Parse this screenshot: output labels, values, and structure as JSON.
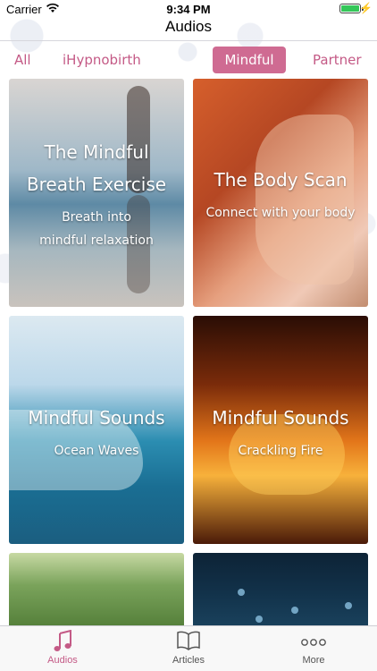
{
  "status_bar": {
    "carrier": "Carrier",
    "time": "9:34 PM"
  },
  "nav": {
    "title": "Audios"
  },
  "segments": [
    "All",
    "iHypnobirth",
    "Mindful",
    "Partner"
  ],
  "selected_segment": "Mindful",
  "cards": [
    {
      "title": "The Mindful Breath Exercise",
      "title_line1": "The Mindful",
      "title_line2": "Breath Exercise",
      "subtitle_line1": "Breath into",
      "subtitle_line2": "mindful relaxation",
      "image": "pregnant-woman-reflection-image"
    },
    {
      "title": "The Body Scan",
      "subtitle": "Connect with your body",
      "image": "pregnant-woman-sitting-image"
    },
    {
      "title": "Mindful Sounds",
      "subtitle": "Ocean Waves",
      "image": "ocean-wave-image"
    },
    {
      "title": "Mindful Sounds",
      "subtitle": "Crackling Fire",
      "image": "fire-image"
    },
    {
      "title": "",
      "subtitle": "",
      "image": "forest-image"
    },
    {
      "title": "",
      "subtitle": "",
      "image": "rain-drops-image"
    }
  ],
  "tab_bar": {
    "items": [
      {
        "label": "Audios",
        "icon": "music-note-icon",
        "active": true
      },
      {
        "label": "Articles",
        "icon": "book-icon",
        "active": false
      },
      {
        "label": "More",
        "icon": "ellipsis-icon",
        "active": false
      }
    ]
  },
  "colors": {
    "accent": "#cf6b92",
    "accent_text": "#c45a86"
  }
}
